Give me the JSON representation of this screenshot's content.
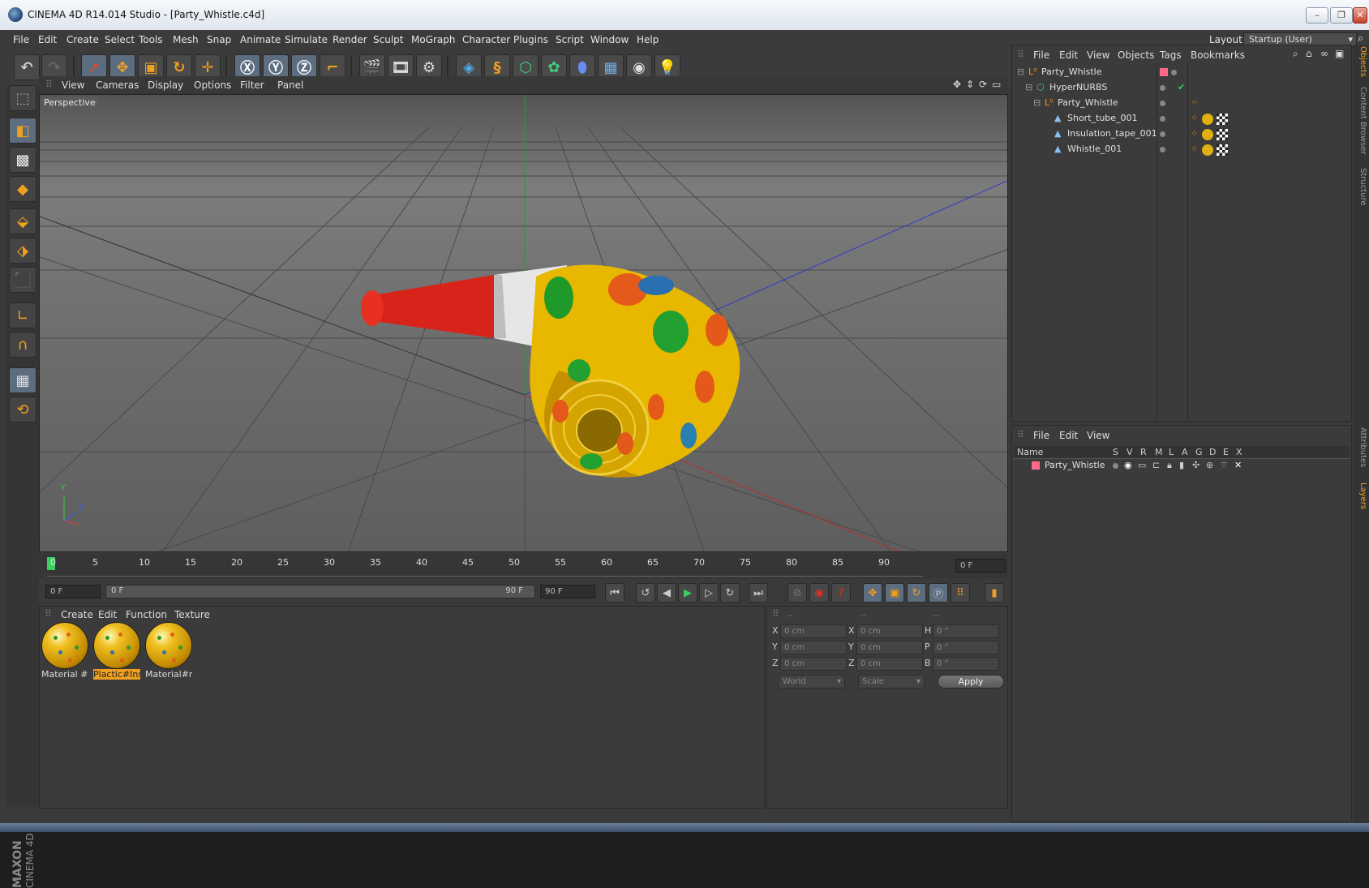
{
  "window": {
    "title": "CINEMA 4D R14.014 Studio - [Party_Whistle.c4d]",
    "min": "–",
    "max": "❐",
    "close": "✕"
  },
  "menu": [
    "File",
    "Edit",
    "Create",
    "Select",
    "Tools",
    "Mesh",
    "Snap",
    "Animate",
    "Simulate",
    "Render",
    "Sculpt",
    "MoGraph",
    "Character",
    "Plugins",
    "Script",
    "Window",
    "Help"
  ],
  "layout": {
    "label": "Layout:",
    "value": "Startup (User)"
  },
  "viewport": {
    "menu": [
      "View",
      "Cameras",
      "Display",
      "Options",
      "Filter",
      "Panel"
    ],
    "label": "Perspective",
    "axis_y": "Y",
    "axis_z": "Z"
  },
  "timeline": {
    "ticks": [
      "0",
      "5",
      "10",
      "15",
      "20",
      "25",
      "30",
      "35",
      "40",
      "45",
      "50",
      "55",
      "60",
      "65",
      "70",
      "75",
      "80",
      "85",
      "90"
    ],
    "current": "0 F",
    "start": "0 F",
    "range_start": "0 F",
    "range_end": "90 F",
    "end": "90 F"
  },
  "materials": {
    "menu": [
      "Create",
      "Edit",
      "Function",
      "Texture"
    ],
    "items": [
      {
        "label": "Material #r"
      },
      {
        "label": "Plactic#Insi"
      },
      {
        "label": "Material#re"
      }
    ]
  },
  "coords": {
    "headers": [
      "--",
      "--",
      "--"
    ],
    "rows": [
      {
        "a": "X",
        "av": "0 cm",
        "b": "X",
        "bv": "0 cm",
        "c": "H",
        "cv": "0 °"
      },
      {
        "a": "Y",
        "av": "0 cm",
        "b": "Y",
        "bv": "0 cm",
        "c": "P",
        "cv": "0 °"
      },
      {
        "a": "Z",
        "av": "0 cm",
        "b": "Z",
        "bv": "0 cm",
        "c": "B",
        "cv": "0 °"
      }
    ],
    "world": "World",
    "scale": "Scale",
    "apply": "Apply"
  },
  "objects": {
    "menu": [
      "File",
      "Edit",
      "View",
      "Objects",
      "Tags",
      "Bookmarks"
    ],
    "tree": [
      {
        "name": "Party_Whistle",
        "depth": 0
      },
      {
        "name": "HyperNURBS",
        "depth": 1
      },
      {
        "name": "Party_Whistle",
        "depth": 2
      },
      {
        "name": "Short_tube_001",
        "depth": 3
      },
      {
        "name": "Insulation_tape_001",
        "depth": 3
      },
      {
        "name": "Whistle_001",
        "depth": 3
      }
    ]
  },
  "layers": {
    "menu": [
      "File",
      "Edit",
      "View"
    ],
    "columns": [
      "Name",
      "S",
      "V",
      "R",
      "M",
      "L",
      "A",
      "G",
      "D",
      "E",
      "X"
    ],
    "rows": [
      {
        "name": "Party_Whistle"
      }
    ]
  },
  "side_tabs": [
    "Objects",
    "Content Browser",
    "Structure",
    "Attributes",
    "Layers"
  ],
  "brand": {
    "maxon": "MAXON",
    "product": "CINEMA 4D"
  },
  "colors": {
    "accent": "#f0a020",
    "panel": "#3b3b3b",
    "layer_color": "#ff6a8a"
  }
}
